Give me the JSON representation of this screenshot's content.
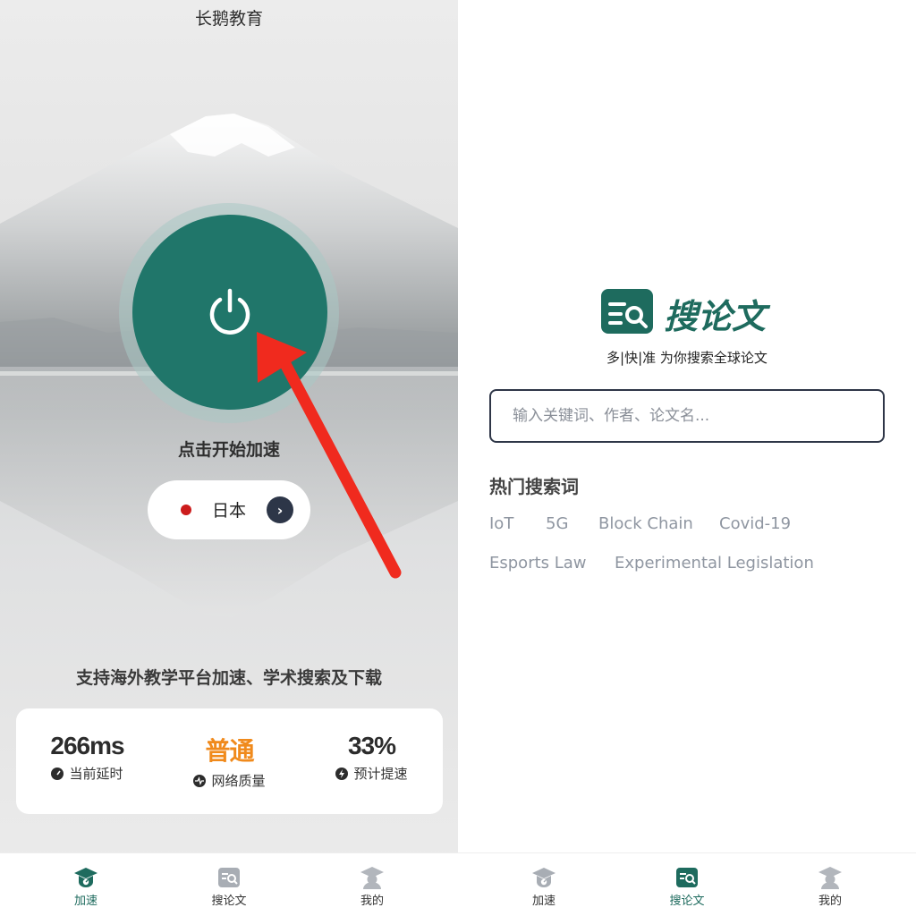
{
  "left": {
    "app_title": "长鹅教育",
    "start_label": "点击开始加速",
    "region": {
      "name": "日本"
    },
    "support_text": "支持海外教学平台加速、学术搜索及下载",
    "stats": [
      {
        "value": "266ms",
        "label": "当前延时",
        "icon": "gauge-icon"
      },
      {
        "value": "普通",
        "label": "网络质量",
        "icon": "pulse-icon"
      },
      {
        "value": "33%",
        "label": "预计提速",
        "icon": "bolt-icon"
      }
    ],
    "tabs": [
      {
        "label": "加速",
        "icon": "graduation-cap-speed-icon",
        "active": true
      },
      {
        "label": "搜论文",
        "icon": "search-paper-icon",
        "active": false
      },
      {
        "label": "我的",
        "icon": "profile-cap-icon",
        "active": false
      }
    ]
  },
  "right": {
    "logo_text": "搜论文",
    "slogan": "多|快|准 为你搜索全球论文",
    "search": {
      "placeholder": "输入关键词、作者、论文名..."
    },
    "hot_title": "热门搜索词",
    "hot_tags": [
      "IoT",
      "5G",
      "Block Chain",
      "Covid-19",
      "Esports Law",
      "Experimental Legislation"
    ],
    "tabs": [
      {
        "label": "加速",
        "icon": "graduation-cap-speed-icon",
        "active": false
      },
      {
        "label": "搜论文",
        "icon": "search-paper-icon",
        "active": true
      },
      {
        "label": "我的",
        "icon": "profile-cap-icon",
        "active": false
      }
    ]
  },
  "colors": {
    "accent": "#1e6b5e",
    "power_button": "#20766a",
    "quality_orange": "#f08a1c",
    "arrow_red": "#f02a1e"
  }
}
